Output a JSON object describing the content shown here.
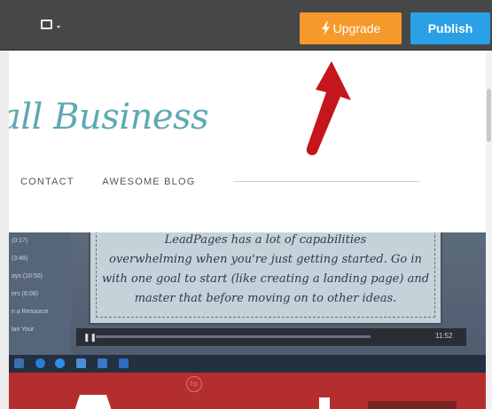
{
  "toolbar": {
    "upgrade_label": "Upgrade",
    "publish_label": "Publish",
    "device_icon": "desktop-preview-icon",
    "upgrade_icon": "lightning-bolt-icon"
  },
  "site": {
    "logo_text": "all Business",
    "nav": [
      "CONTACT",
      "AWESOME BLOG"
    ]
  },
  "photo": {
    "slide_text": "LeadPages has a lot of capabilities... overwhelming when you're just getting started. Go in with one goal to start (like creating a landing page) and master that before moving on to other ideas.",
    "slide_line_1": "LeadPages has a lot of capabilities",
    "slide_line_2": "overwhelming when you're just getting started. Go in",
    "slide_line_3": "with one goal to start (like creating a landing page) and",
    "slide_line_4": "master that before moving on to other ideas.",
    "sidebar_items": [
      "(0:17)",
      "(3:48)",
      "ays (10:50)",
      "ers (8:08)",
      "n a Resource",
      "lan Your"
    ],
    "player_time": "11:52",
    "hp_logo": "hp"
  },
  "colors": {
    "topbar": "#454748",
    "upgrade": "#f59a2b",
    "publish": "#2aa0e6",
    "logo": "#5ea9b3",
    "arrow": "#c4161c"
  }
}
